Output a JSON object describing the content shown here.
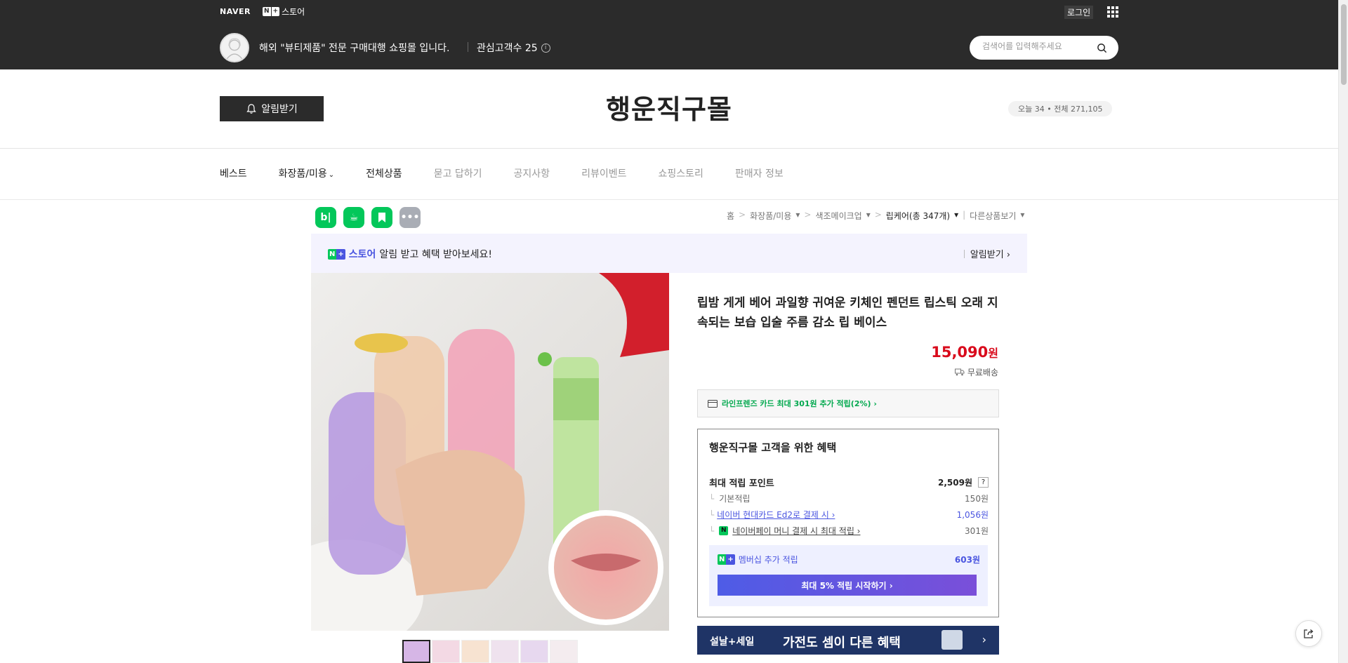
{
  "top": {
    "naver_logo": "NAVER",
    "store_logo": "스토어",
    "login": "로그인",
    "description": "해외 \"뷰티제품\" 전문 구매대행 쇼핑몰 입니다.",
    "favorites": "관심고객수 25",
    "search_placeholder": "검색어를 입력해주세요"
  },
  "header": {
    "alarm_button": "알림받기",
    "store_name": "행운직구몰",
    "visits": "오늘 34 • 전체 271,105"
  },
  "nav": {
    "items": [
      "베스트",
      "화장품/미용",
      "전체상품",
      "묻고 답하기",
      "공지사항",
      "리뷰이벤트",
      "쇼핑스토리",
      "판매자 정보"
    ]
  },
  "share_icons": [
    "blog-icon",
    "cafe-icon",
    "bookmark-icon",
    "more-icon"
  ],
  "breadcrumb": {
    "items": [
      "홈",
      "화장품/미용",
      "색조메이크업",
      "립케어(총 347개)",
      "다른상품보기"
    ]
  },
  "promo": {
    "store": "스토어",
    "text": "알림 받고 혜택 받아보세요!",
    "action": "알림받기 ›"
  },
  "product": {
    "title": "립밤 게게 베어 과일향 귀여운 키체인 펜던트 립스틱 오래 지속되는 보습 입술 주름 감소 립 베이스",
    "price": "15,090",
    "price_unit": "원",
    "shipping": "무료배송",
    "card_offer": "라인프렌즈 카드 최대 301원 추가 적립(2%) ›"
  },
  "benefit": {
    "title": "행운직구몰 고객을 위한 혜택",
    "max_points_label": "최대 적립 포인트",
    "max_points_value": "2,509원",
    "qmark": "?",
    "basic_label": "기본적립",
    "basic_value": "150원",
    "card_label": "네이버 현대카드 Ed2로 결제 시 ›",
    "card_value": "1,056원",
    "npay_label": "네이버페이 머니 결제 시 최대 적립 ›",
    "npay_value": "301원",
    "member_label": "멤버십 추가 적립",
    "member_value": "603원",
    "member_button": "최대 5% 적립 시작하기 ›"
  },
  "sale_banner": {
    "left": "설날+세일",
    "mid": "가전도 셈이 다른 혜택",
    "arrow": "›"
  },
  "colors": {
    "topbar": "#2b2b2b",
    "price_red": "#d90b1c",
    "naver_green": "#03c75a",
    "plus_purple": "#4a55e0"
  }
}
